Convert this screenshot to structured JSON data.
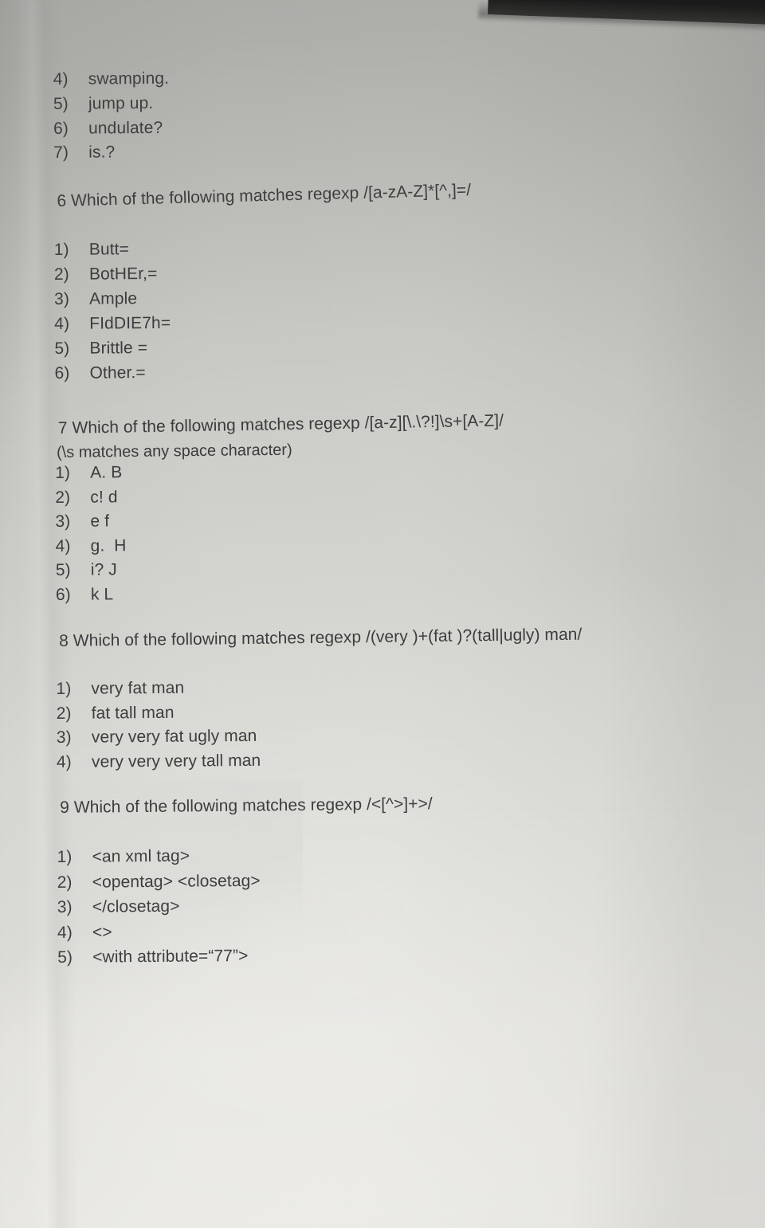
{
  "document": {
    "type": "printed-exam-page-photo",
    "background_color": "#cfcfca",
    "text_color": "#3c3c3e",
    "dark_edge_color": "#0d0d0d"
  },
  "continued_options": {
    "items": [
      {
        "num": "4)",
        "text": "swamping."
      },
      {
        "num": "5)",
        "text": "jump up."
      },
      {
        "num": "6)",
        "text": "undulate?"
      },
      {
        "num": "7)",
        "text": "is.?"
      }
    ]
  },
  "questions": [
    {
      "number": "6",
      "heading": "6 Which of the following matches regexp /[a-zA-Z]*[^,]=/",
      "note": "",
      "options": [
        {
          "num": "1)",
          "text": "Butt="
        },
        {
          "num": "2)",
          "text": "BotHEr,="
        },
        {
          "num": "3)",
          "text": "Ample"
        },
        {
          "num": "4)",
          "text": "FIdDIE7h="
        },
        {
          "num": "5)",
          "text": "Brittle ="
        },
        {
          "num": "6)",
          "text": "Other.="
        }
      ]
    },
    {
      "number": "7",
      "heading": "7 Which of the following matches regexp /[a-z][\\.\\?!]\\s+[A-Z]/",
      "note": "(\\s matches any space character)",
      "options": [
        {
          "num": "1)",
          "text": "A. B"
        },
        {
          "num": "2)",
          "text": "c! d"
        },
        {
          "num": "3)",
          "text": "e f"
        },
        {
          "num": "4)",
          "text": "g.  H"
        },
        {
          "num": "5)",
          "text": "i? J"
        },
        {
          "num": "6)",
          "text": "k L"
        }
      ]
    },
    {
      "number": "8",
      "heading": "8 Which of the following matches regexp /(very )+(fat )?(tall|ugly) man/",
      "note": "",
      "options": [
        {
          "num": "1)",
          "text": "very fat man"
        },
        {
          "num": "2)",
          "text": "fat tall man"
        },
        {
          "num": "3)",
          "text": "very very fat ugly man"
        },
        {
          "num": "4)",
          "text": "very very very tall man"
        }
      ]
    },
    {
      "number": "9",
      "heading": "9 Which of the following matches regexp /<[^>]+>/",
      "note": "",
      "options": [
        {
          "num": "1)",
          "text": "<an xml tag>"
        },
        {
          "num": "2)",
          "text": "<opentag> <closetag>"
        },
        {
          "num": "3)",
          "text": "</closetag>"
        },
        {
          "num": "4)",
          "text": "<>"
        },
        {
          "num": "5)",
          "text": "<with attribute=“77”>"
        }
      ]
    }
  ]
}
